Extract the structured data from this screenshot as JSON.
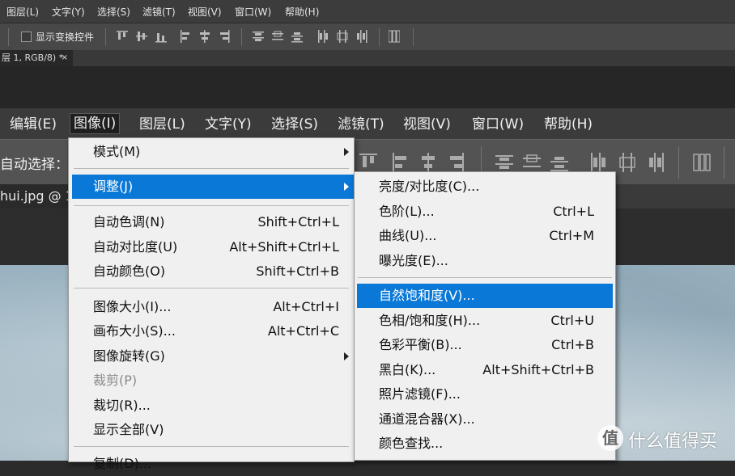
{
  "back_window": {
    "menu": [
      "图层(L)",
      "文字(Y)",
      "选择(S)",
      "滤镜(T)",
      "视图(V)",
      "窗口(W)",
      "帮助(H)"
    ],
    "options": {
      "show_transform_label": "显示变换控件"
    },
    "tab": {
      "title": "层 1, RGB/8) *",
      "close": "×"
    }
  },
  "front_window": {
    "menu": [
      "编辑(E)",
      "图像(I)",
      "图层(L)",
      "文字(Y)",
      "选择(S)",
      "滤镜(T)",
      "视图(V)",
      "窗口(W)",
      "帮助(H)"
    ],
    "active_menu_index": 1,
    "options": {
      "auto_select_label": "自动选择："
    },
    "tab": {
      "title": "hui.jpg @ 1"
    }
  },
  "image_menu": {
    "items": [
      {
        "label": "模式(M)",
        "shortcut": "",
        "submenu": true
      },
      {
        "label": "调整(J)",
        "shortcut": "",
        "submenu": true,
        "highlighted": true
      },
      {
        "label": "自动色调(N)",
        "shortcut": "Shift+Ctrl+L"
      },
      {
        "label": "自动对比度(U)",
        "shortcut": "Alt+Shift+Ctrl+L"
      },
      {
        "label": "自动颜色(O)",
        "shortcut": "Shift+Ctrl+B"
      },
      {
        "label": "图像大小(I)...",
        "shortcut": "Alt+Ctrl+I"
      },
      {
        "label": "画布大小(S)...",
        "shortcut": "Alt+Ctrl+C"
      },
      {
        "label": "图像旋转(G)",
        "shortcut": "",
        "submenu": true
      },
      {
        "label": "裁剪(P)",
        "shortcut": "",
        "disabled": true
      },
      {
        "label": "裁切(R)...",
        "shortcut": ""
      },
      {
        "label": "显示全部(V)",
        "shortcut": ""
      },
      {
        "label": "复制(D)...",
        "shortcut": ""
      }
    ]
  },
  "adjust_submenu": {
    "items": [
      {
        "label": "亮度/对比度(C)...",
        "shortcut": ""
      },
      {
        "label": "色阶(L)...",
        "shortcut": "Ctrl+L"
      },
      {
        "label": "曲线(U)...",
        "shortcut": "Ctrl+M"
      },
      {
        "label": "曝光度(E)...",
        "shortcut": ""
      },
      {
        "label": "自然饱和度(V)...",
        "shortcut": "",
        "highlighted": true
      },
      {
        "label": "色相/饱和度(H)...",
        "shortcut": "Ctrl+U"
      },
      {
        "label": "色彩平衡(B)...",
        "shortcut": "Ctrl+B"
      },
      {
        "label": "黑白(K)...",
        "shortcut": "Alt+Shift+Ctrl+B"
      },
      {
        "label": "照片滤镜(F)...",
        "shortcut": ""
      },
      {
        "label": "通道混合器(X)...",
        "shortcut": ""
      },
      {
        "label": "颜色查找...",
        "shortcut": ""
      }
    ]
  },
  "watermark": {
    "badge": "值",
    "text": "什么值得买"
  },
  "colors": {
    "highlight": "#0a78d7",
    "menu_bg": "#f0f0f0"
  }
}
